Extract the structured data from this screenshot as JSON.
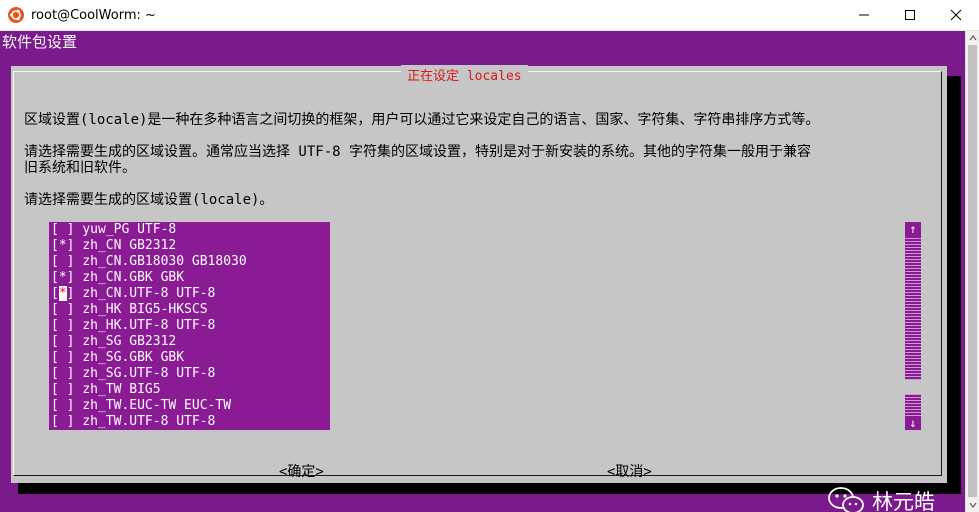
{
  "window": {
    "title": "root@CoolWorm: ~"
  },
  "terminal": {
    "package_title": "软件包设置"
  },
  "dialog": {
    "title": "正在设定 locales",
    "line1": "区域设置(locale)是一种在多种语言之间切换的框架，用户可以通过它来设定自己的语言、国家、字符集、字符串排序方式等。",
    "line2": "请选择需要生成的区域设置。通常应当选择 UTF-8 字符集的区域设置，特别是对于新安装的系统。其他的字符集一般用于兼容",
    "line3": "旧系统和旧软件。",
    "prompt": "请选择需要生成的区域设置(locale)。",
    "locales": [
      {
        "mark": " ",
        "label": "yuw_PG UTF-8"
      },
      {
        "mark": "*",
        "label": "zh_CN GB2312"
      },
      {
        "mark": " ",
        "label": "zh_CN.GB18030 GB18030"
      },
      {
        "mark": "*",
        "label": "zh_CN.GBK GBK"
      },
      {
        "mark": "*",
        "label": "zh_CN.UTF-8 UTF-8"
      },
      {
        "mark": " ",
        "label": "zh_HK BIG5-HKSCS"
      },
      {
        "mark": " ",
        "label": "zh_HK.UTF-8 UTF-8"
      },
      {
        "mark": " ",
        "label": "zh_SG GB2312"
      },
      {
        "mark": " ",
        "label": "zh_SG.GBK GBK"
      },
      {
        "mark": " ",
        "label": "zh_SG.UTF-8 UTF-8"
      },
      {
        "mark": " ",
        "label": "zh_TW BIG5"
      },
      {
        "mark": " ",
        "label": "zh_TW.EUC-TW EUC-TW"
      },
      {
        "mark": " ",
        "label": "zh_TW.UTF-8 UTF-8"
      }
    ],
    "focused_index": 4,
    "scroll_up": "↑",
    "scroll_down": "↓",
    "ok_label": "<确定>",
    "cancel_label": "<取消>"
  },
  "watermark": {
    "text": "林元皓"
  },
  "colors": {
    "terminal_bg": "#7a1a8c",
    "dialog_bg": "#c6c6c6",
    "list_bg": "#8b1a95",
    "title_red": "#d61b1b",
    "ubuntu_orange": "#e95420"
  },
  "icons": {
    "app": "ubuntu-icon",
    "minimize": "minimize-icon",
    "maximize": "maximize-icon",
    "close": "close-icon",
    "watermark": "wechat-icon"
  }
}
